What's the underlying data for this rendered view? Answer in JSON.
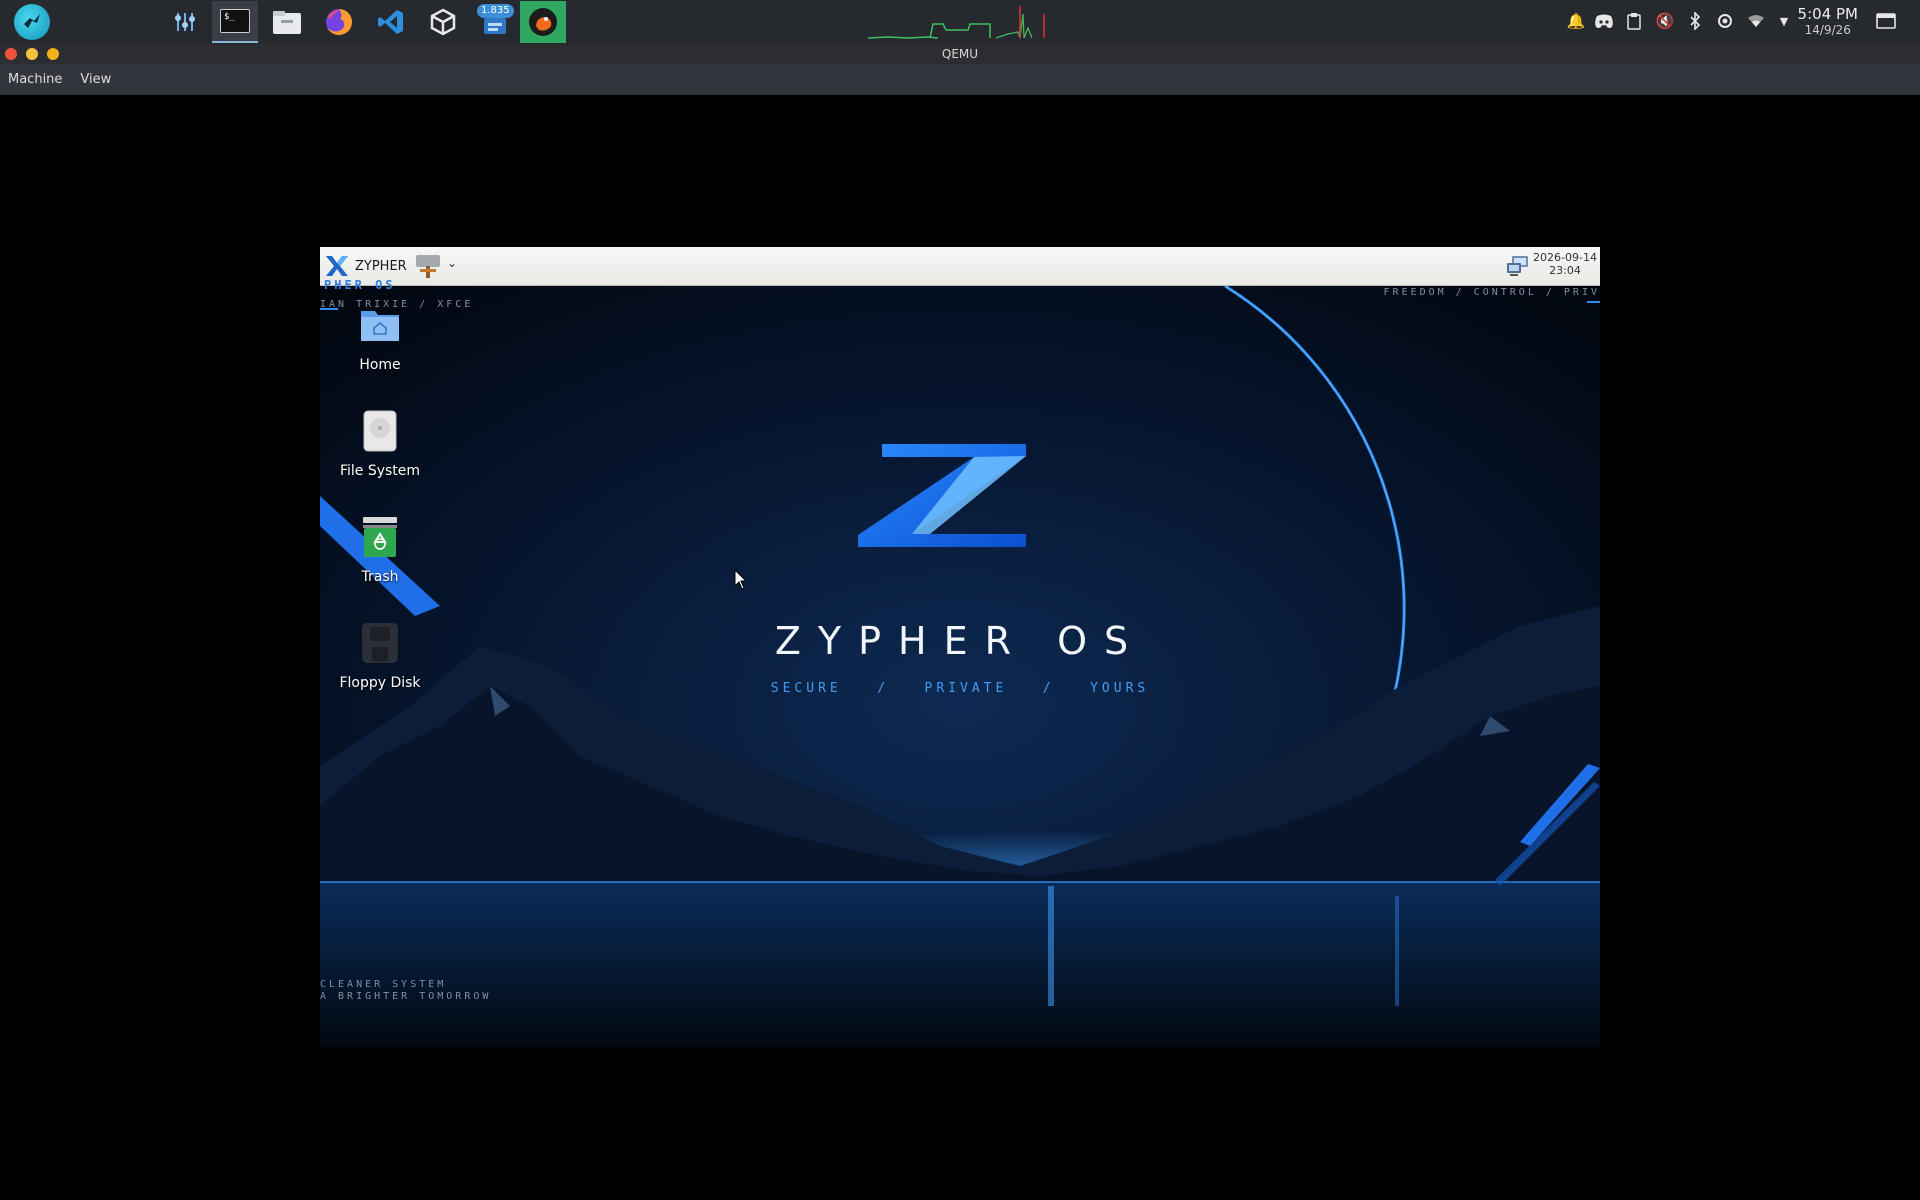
{
  "host_taskbar": {
    "apps": [
      {
        "name": "settings-sliders-icon"
      },
      {
        "name": "terminal-icon",
        "label": "$_"
      },
      {
        "name": "file-manager-icon"
      },
      {
        "name": "firefox-icon"
      },
      {
        "name": "vscode-icon"
      },
      {
        "name": "unity-icon"
      },
      {
        "name": "network-monitor-icon",
        "badge": "1.835"
      },
      {
        "name": "qemu-icon"
      }
    ],
    "clock": {
      "time": "5:04 PM",
      "date": "14/9/26"
    }
  },
  "qemu_window": {
    "title": "QEMU",
    "menu": [
      "Machine",
      "View"
    ]
  },
  "guest": {
    "panel": {
      "app_menu_label": "ZYPHER",
      "clock_date": "2026-09-14",
      "clock_time": "23:04"
    },
    "desktop_icons": [
      {
        "label": "Home"
      },
      {
        "label": "File System"
      },
      {
        "label": "Trash"
      },
      {
        "label": "Floppy Disk"
      }
    ],
    "wallpaper": {
      "corner_top_left_1": "PHER OS",
      "corner_top_left_2": "IAN TRIXIE  /  XFCE",
      "corner_top_right": "FREEDOM  /  CONTROL  /  PRIV",
      "title": "ZYPHER OS",
      "subtitle": "SECURE   /   PRIVATE   /   YOURS",
      "bottom_left_1": "CLEANER SYSTEM",
      "bottom_left_2": "A BRIGHTER TOMORROW",
      "accent": "#2f8cf2"
    }
  }
}
